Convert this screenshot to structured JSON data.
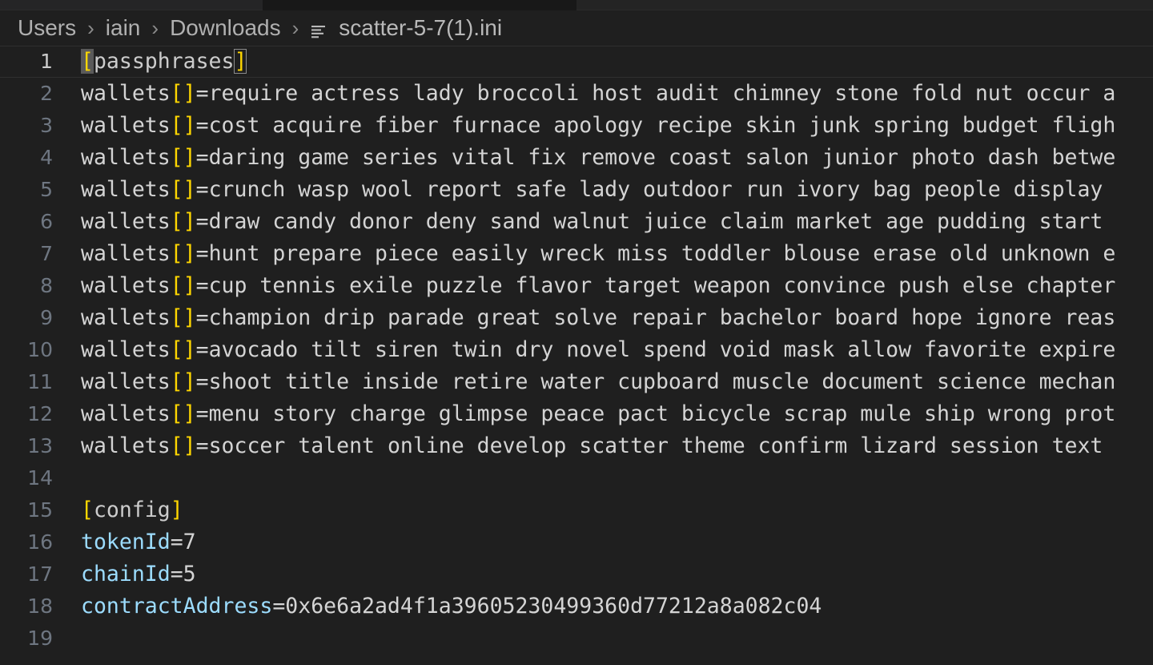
{
  "window": {
    "background": "#1f1f1f",
    "accent_bracket_color": "#ffd700",
    "key_color": "#9cdcfe",
    "text_color": "#d4d4d4"
  },
  "breadcrumb": {
    "segments": [
      "Users",
      "iain",
      "Downloads"
    ],
    "separator": "›",
    "file_name": "scatter-5-7(1).ini",
    "file_icon": "ini-settings-icon"
  },
  "editor": {
    "language": "ini",
    "active_line": 1,
    "cursor_selection_text": "[",
    "bracket_match_text": "]",
    "lines": [
      {
        "number": "1",
        "type": "section",
        "bracket_open": "[",
        "name": "passphrases",
        "bracket_close": "]",
        "text": "[passphrases]"
      },
      {
        "number": "2",
        "type": "array",
        "key": "wallets",
        "brackets": "[]",
        "eq": "=",
        "value": "require actress lady broccoli host audit chimney stone fold nut occur a"
      },
      {
        "number": "3",
        "type": "array",
        "key": "wallets",
        "brackets": "[]",
        "eq": "=",
        "value": "cost acquire fiber furnace apology recipe skin junk spring budget fligh"
      },
      {
        "number": "4",
        "type": "array",
        "key": "wallets",
        "brackets": "[]",
        "eq": "=",
        "value": "daring game series vital fix remove coast salon junior photo dash betwe"
      },
      {
        "number": "5",
        "type": "array",
        "key": "wallets",
        "brackets": "[]",
        "eq": "=",
        "value": "crunch wasp wool report safe lady outdoor run ivory bag people display"
      },
      {
        "number": "6",
        "type": "array",
        "key": "wallets",
        "brackets": "[]",
        "eq": "=",
        "value": "draw candy donor deny sand walnut juice claim market age pudding start"
      },
      {
        "number": "7",
        "type": "array",
        "key": "wallets",
        "brackets": "[]",
        "eq": "=",
        "value": "hunt prepare piece easily wreck miss toddler blouse erase old unknown e"
      },
      {
        "number": "8",
        "type": "array",
        "key": "wallets",
        "brackets": "[]",
        "eq": "=",
        "value": "cup tennis exile puzzle flavor target weapon convince push else chapter"
      },
      {
        "number": "9",
        "type": "array",
        "key": "wallets",
        "brackets": "[]",
        "eq": "=",
        "value": "champion drip parade great solve repair bachelor board hope ignore reas"
      },
      {
        "number": "10",
        "type": "array",
        "key": "wallets",
        "brackets": "[]",
        "eq": "=",
        "value": "avocado tilt siren twin dry novel spend void mask allow favorite expire"
      },
      {
        "number": "11",
        "type": "array",
        "key": "wallets",
        "brackets": "[]",
        "eq": "=",
        "value": "shoot title inside retire water cupboard muscle document science mechan"
      },
      {
        "number": "12",
        "type": "array",
        "key": "wallets",
        "brackets": "[]",
        "eq": "=",
        "value": "menu story charge glimpse peace pact bicycle scrap mule ship wrong prot"
      },
      {
        "number": "13",
        "type": "array",
        "key": "wallets",
        "brackets": "[]",
        "eq": "=",
        "value": "soccer talent online develop scatter theme confirm lizard session text"
      },
      {
        "number": "14",
        "type": "blank",
        "text": ""
      },
      {
        "number": "15",
        "type": "section",
        "bracket_open": "[",
        "name": "config",
        "bracket_close": "]",
        "text": "[config]"
      },
      {
        "number": "16",
        "type": "pair",
        "key": "tokenId",
        "eq": "=",
        "value": "7"
      },
      {
        "number": "17",
        "type": "pair",
        "key": "chainId",
        "eq": "=",
        "value": "5"
      },
      {
        "number": "18",
        "type": "pair",
        "key": "contractAddress",
        "eq": "=",
        "value": "0x6e6a2ad4f1a39605230499360d77212a8a082c04"
      },
      {
        "number": "19",
        "type": "blank",
        "text": ""
      }
    ]
  }
}
